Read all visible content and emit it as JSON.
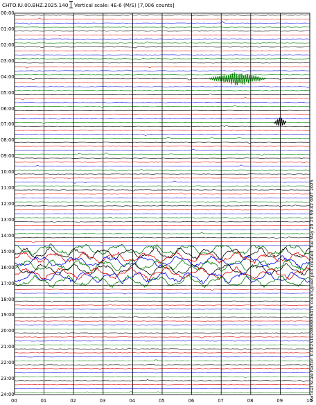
{
  "header": {
    "station": "CHTO.IU.00.BHZ.2025.140",
    "vertical_scale": "Vertical scale: 4E-6 (M/S) [7,006 counts]"
  },
  "hour_labels": [
    "00:00",
    "01:00",
    "02:00",
    "03:00",
    "04:00",
    "05:00",
    "06:00",
    "07:00",
    "08:00",
    "09:00",
    "10:00",
    "11:00",
    "12:00",
    "13:00",
    "14:00",
    "15:00",
    "16:00",
    "17:00",
    "18:00",
    "19:00",
    "20:00",
    "21:00",
    "22:00",
    "23:00",
    "24:00"
  ],
  "minute_labels": [
    "00",
    "01",
    "02",
    "03",
    "04",
    "05",
    "06",
    "07",
    "08",
    "09",
    "10"
  ],
  "footer_text": "Vertical Scale Factor: 0.00251920868836475 counts/pixel plot created: Tue May 20 23:59:42 GMT 2025",
  "colors": {
    "background": "#ffffff",
    "trace_cycle": [
      "#000000",
      "#e00000",
      "#0000e0",
      "#008000"
    ],
    "grid": "#000000"
  },
  "events": [
    {
      "name": "earthquake-arrival-04h",
      "hour": 3.9,
      "minute_start": 6.6,
      "minute_end": 8.5,
      "color": "#008000"
    },
    {
      "name": "local-event-07h",
      "hour": 6.75,
      "minute_start": 8.8,
      "minute_end": 9.2,
      "color": "#000000"
    }
  ],
  "noise_window": {
    "hour_start": 14.7,
    "hour_end": 16.8,
    "label": "high-amplitude noise"
  }
}
